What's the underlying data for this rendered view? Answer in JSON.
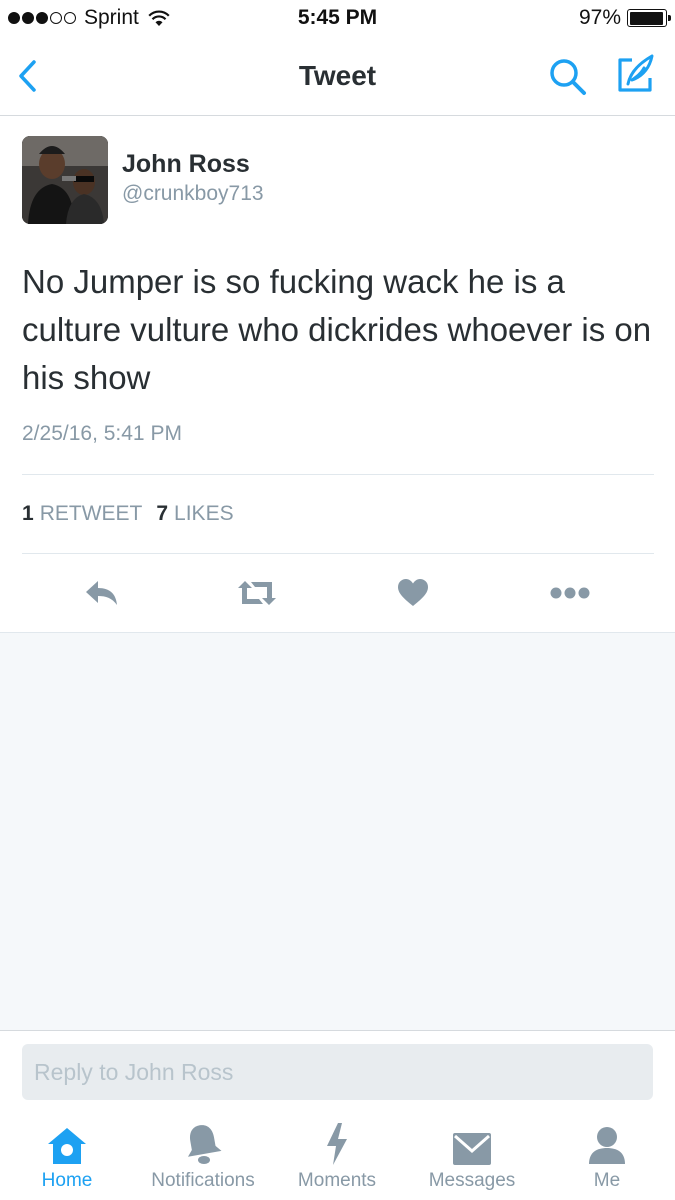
{
  "status_bar": {
    "carrier": "Sprint",
    "time": "5:45 PM",
    "battery_percent": "97%",
    "battery_level": 0.97,
    "signal_bars": 3
  },
  "nav": {
    "title": "Tweet",
    "back_icon": "chevron-left-icon",
    "search_icon": "search-icon",
    "compose_icon": "compose-icon"
  },
  "tweet": {
    "author_name": "John Ross",
    "author_handle": "@crunkboy713",
    "text": "No Jumper is so fucking wack he is a culture vulture who dickrides whoever is on his show",
    "timestamp": "2/25/16, 5:41 PM",
    "retweet_count": "1",
    "retweet_label": "RETWEET",
    "like_count": "7",
    "like_label": "LIKES"
  },
  "actions": [
    "reply-icon",
    "retweet-icon",
    "heart-icon",
    "more-icon"
  ],
  "reply": {
    "placeholder": "Reply to John Ross"
  },
  "tabs": [
    {
      "label": "Home",
      "icon": "home-icon",
      "active": true
    },
    {
      "label": "Notifications",
      "icon": "bell-icon",
      "active": false
    },
    {
      "label": "Moments",
      "icon": "lightning-icon",
      "active": false
    },
    {
      "label": "Messages",
      "icon": "envelope-icon",
      "active": false
    },
    {
      "label": "Me",
      "icon": "person-icon",
      "active": false
    }
  ],
  "colors": {
    "accent": "#1da1f2",
    "icon_gray": "#8899a6",
    "text": "#292f33"
  }
}
